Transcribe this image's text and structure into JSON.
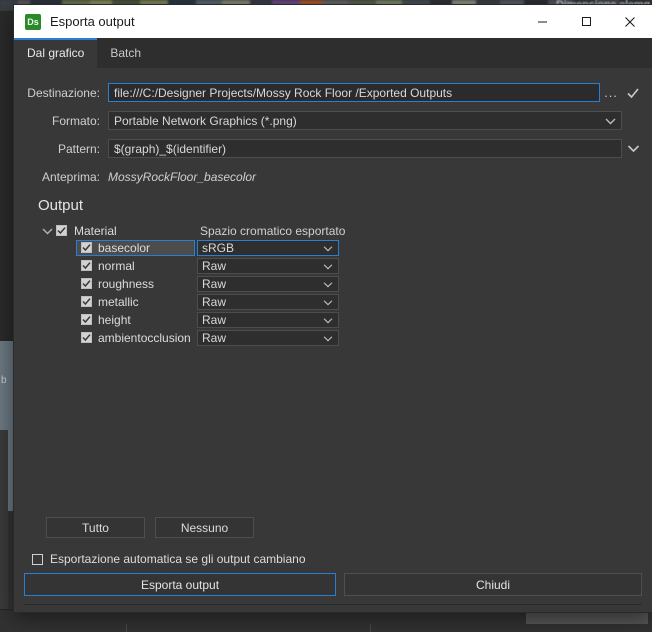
{
  "background": {
    "thumbstrip_label": "Dimensione elemg",
    "left_letter": "b"
  },
  "window": {
    "app_icon": "substance-designer-icon",
    "app_icon_text": "Ds",
    "title": "Esporta output",
    "minimize": "minimize-icon",
    "maximize": "maximize-icon",
    "close": "close-icon"
  },
  "tabs": [
    {
      "label": "Dal grafico",
      "active": true
    },
    {
      "label": "Batch",
      "active": false
    }
  ],
  "form": {
    "destination": {
      "label": "Destinazione:",
      "value": "file:///C:/Designer Projects/Mossy Rock Floor /Exported Outputs",
      "browse_label": "...",
      "confirm_icon": "check-icon"
    },
    "format": {
      "label": "Formato:",
      "value": "Portable Network Graphics (*.png)"
    },
    "pattern": {
      "label": "Pattern:",
      "value": "$(graph)_$(identifier)"
    },
    "preview": {
      "label": "Anteprima:",
      "value": "MossyRockFloor_basecolor"
    }
  },
  "output": {
    "title": "Output",
    "column_header": "Spazio cromatico esportato",
    "group": {
      "name": "Material",
      "checked": true,
      "expanded": true
    },
    "items": [
      {
        "name": "basecolor",
        "checked": true,
        "colorspace": "sRGB",
        "selected": true
      },
      {
        "name": "normal",
        "checked": true,
        "colorspace": "Raw",
        "selected": false
      },
      {
        "name": "roughness",
        "checked": true,
        "colorspace": "Raw",
        "selected": false
      },
      {
        "name": "metallic",
        "checked": true,
        "colorspace": "Raw",
        "selected": false
      },
      {
        "name": "height",
        "checked": true,
        "colorspace": "Raw",
        "selected": false
      },
      {
        "name": "ambientocclusion",
        "checked": true,
        "colorspace": "Raw",
        "selected": false
      }
    ]
  },
  "footer": {
    "select_all": "Tutto",
    "select_none": "Nessuno",
    "auto_export": {
      "label": "Esportazione automatica se gli output cambiano",
      "checked": false
    },
    "export_button": "Esporta output",
    "close_button": "Chiudi"
  },
  "colors": {
    "accent": "#2a7fd4",
    "panel": "#383838",
    "field": "#2e2e2e",
    "titlebar": "#ffffff",
    "app_icon_green": "#2a8a2a"
  }
}
